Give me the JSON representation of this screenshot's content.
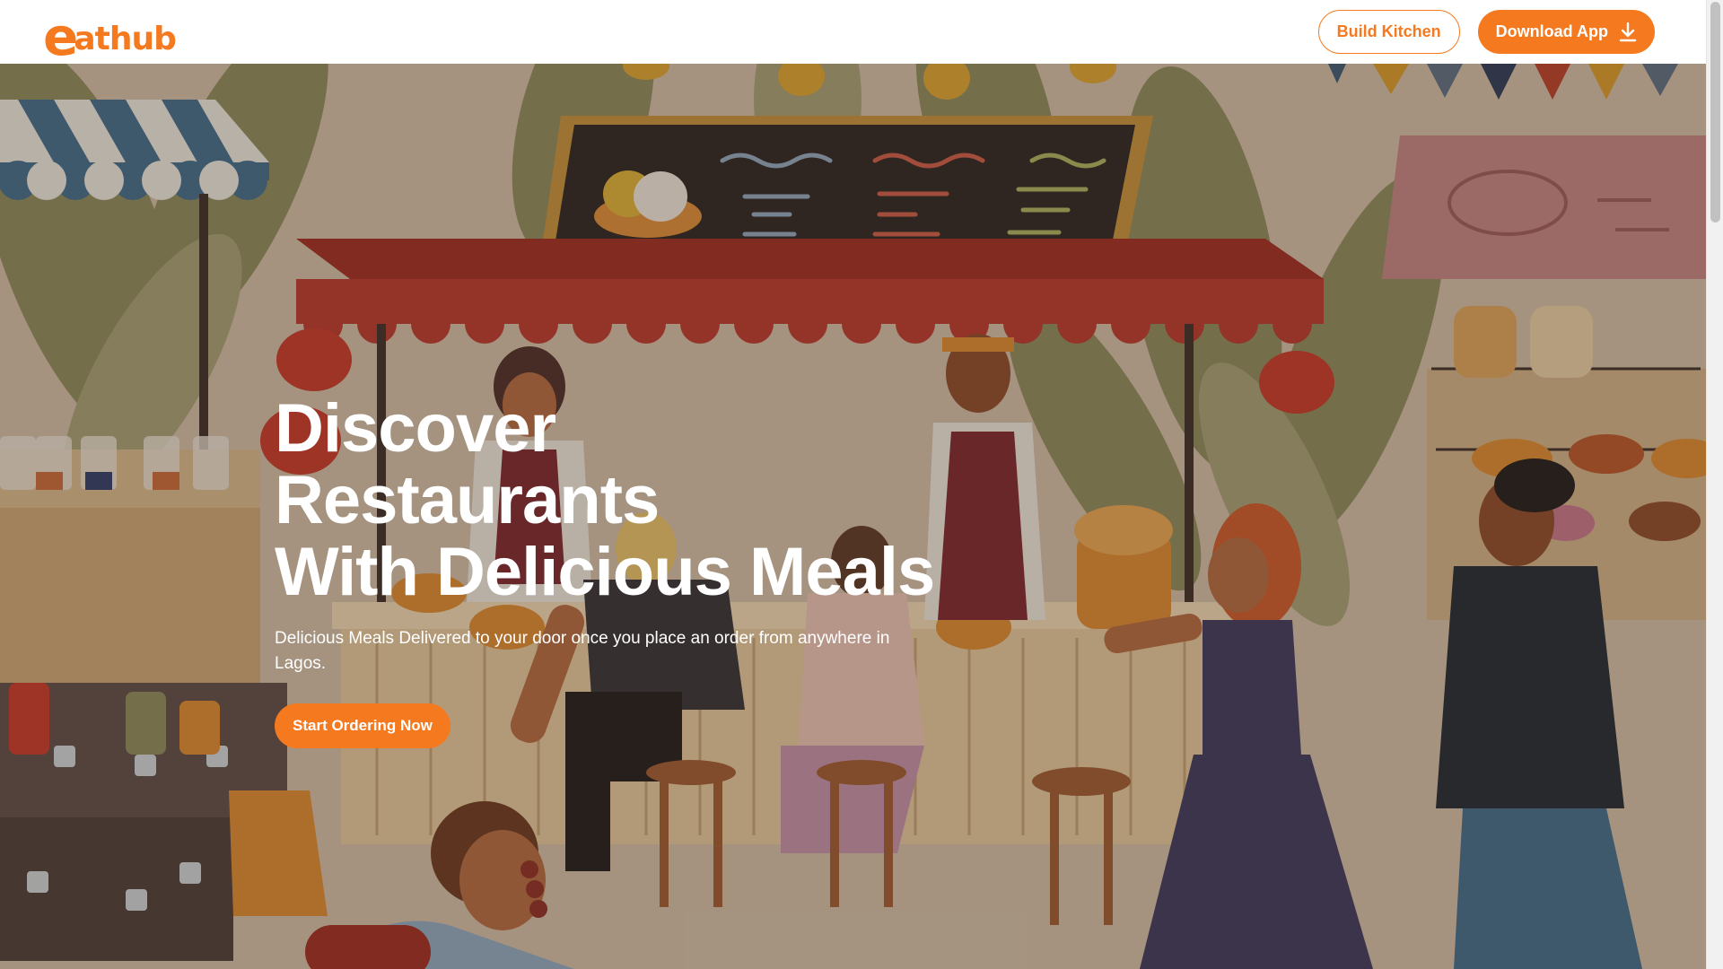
{
  "header": {
    "logo_initial": "e",
    "logo_rest": "athub",
    "build_kitchen_label": "Build Kitchen",
    "download_app_label": "Download App"
  },
  "hero": {
    "title_line1": "Discover Restaurants",
    "title_line2": "With Delicious Meals",
    "subtitle": "Delicious Meals Delivered to your door once you place an order from anywhere in Lagos.",
    "cta_label": "Start Ordering Now"
  },
  "colors": {
    "accent": "#f5791f",
    "white": "#ffffff"
  },
  "icons": {
    "download": "download-icon"
  }
}
